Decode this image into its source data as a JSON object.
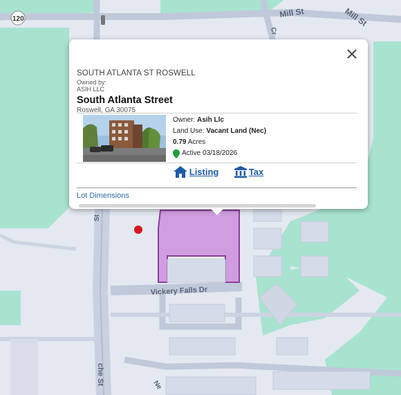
{
  "map": {
    "labels": {
      "route": "120",
      "mill_st_1": "Mill St",
      "mill_st_2": "Mill St",
      "vickery": "Vickery Falls Dr",
      "cross_street": "Cr",
      "s_street": "St",
      "che_st": "che St",
      "ne": "Ne"
    },
    "colors": {
      "background": "#e4e8f1",
      "green_area": "#a8e3d0",
      "road": "#c0c9da",
      "building": "#d5dbe8",
      "parcel": "#d09ee0",
      "parcel_border": "#8b3f9e",
      "marker": "#d7161e"
    }
  },
  "popup": {
    "address_line": "SOUTH ATLANTA ST ROSWELL",
    "owned_by_label": "Owned by:",
    "owner_small": "ASIH LLC",
    "street_name": "South Atlanta Street",
    "city_line": "Roswell, GA 30075",
    "owner_label": "Owner:",
    "owner_value": "Asih Llc",
    "land_use_label": "Land Use:",
    "land_use_value": "Vacant Land (Nec)",
    "acres_value": "0.79",
    "acres_label": "Acres",
    "status": "Active 03/18/2026",
    "listing_link": "Listing",
    "tax_link": "Tax",
    "lot_dimensions": "Lot Dimensions",
    "close_icon": "close-icon"
  }
}
